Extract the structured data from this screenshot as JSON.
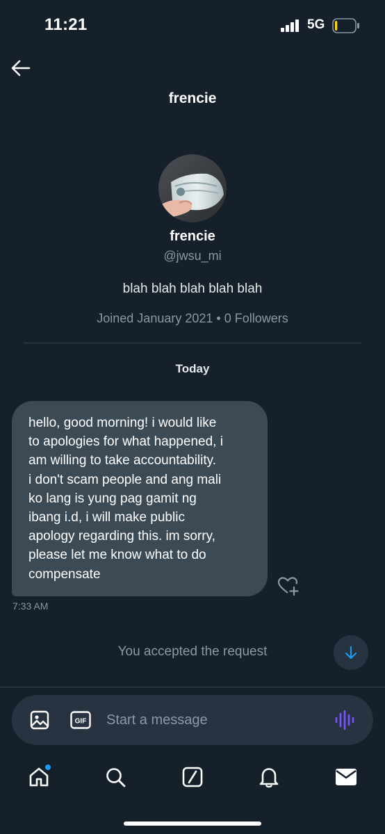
{
  "status_bar": {
    "time": "11:21",
    "network": "5G",
    "battery_level": 0.12,
    "battery_color": "#ffd60a"
  },
  "header": {
    "back_icon": "arrow-left-icon",
    "title": "frencie"
  },
  "profile": {
    "avatar": "avatar-photo",
    "name": "frencie",
    "handle": "@jwsu_mi",
    "bio": "blah blah blah blah blah",
    "meta": "Joined January 2021 • 0 Followers"
  },
  "conversation": {
    "day_label": "Today",
    "messages": [
      {
        "lines": [
          "hello, good morning! i would like",
          "to apologies for what happened, i",
          "am willing to take accountability.",
          "i don't scam people and ang mali",
          "ko lang is yung pag gamit ng",
          "ibang i.d, i will make public",
          "apology regarding this. im sorry,",
          "please let me know what to do",
          "compensate"
        ],
        "time": "7:33 AM"
      }
    ],
    "react_icon": "heart-plus-icon",
    "system_note": "You accepted the request",
    "scroll_icon": "arrow-down-icon"
  },
  "composer": {
    "photo_icon": "image-icon",
    "gif_label": "GIF",
    "placeholder": "Start a message",
    "value": "",
    "voice_icon": "voice-waveform-icon",
    "voice_color": "#7856ff"
  },
  "tab_bar": {
    "tabs": [
      {
        "icon": "home-icon",
        "has_notification": true
      },
      {
        "icon": "search-icon"
      },
      {
        "icon": "grok-icon"
      },
      {
        "icon": "bell-icon"
      },
      {
        "icon": "mail-icon",
        "active": true
      }
    ]
  },
  "colors": {
    "background": "#15202b",
    "bubble": "#3c4a56",
    "accent": "#1d9bf0",
    "muted_text": "#8b98a5"
  }
}
